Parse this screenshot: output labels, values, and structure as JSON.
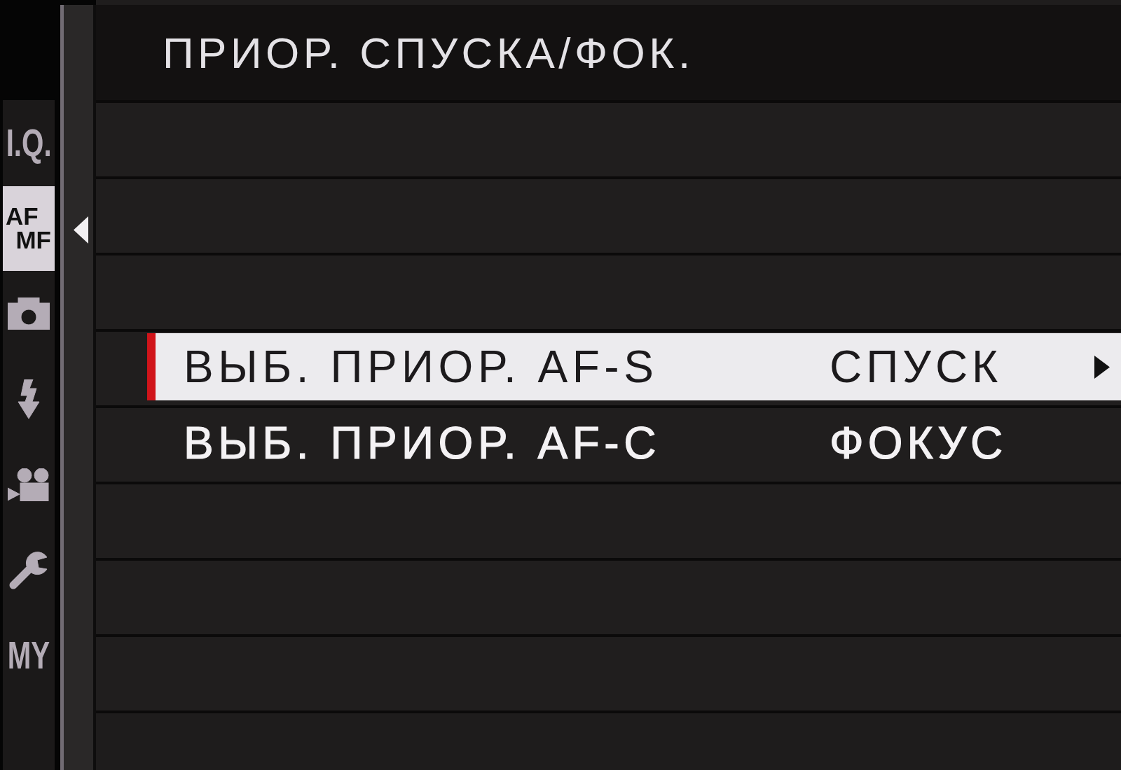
{
  "sidebar": {
    "tabs": [
      {
        "kind": "text",
        "label": "I.Q.",
        "selected": false
      },
      {
        "kind": "stacked",
        "lines": [
          "AF",
          "MF"
        ],
        "selected": true
      },
      {
        "kind": "camera",
        "selected": false
      },
      {
        "kind": "flash",
        "selected": false
      },
      {
        "kind": "movie",
        "selected": false
      },
      {
        "kind": "wrench",
        "selected": false
      },
      {
        "kind": "text",
        "label": "MY",
        "selected": false
      }
    ]
  },
  "menu": {
    "title": "ПРИОР. СПУСКА/ФОК.",
    "rows": [
      {
        "kind": "blank"
      },
      {
        "kind": "blank"
      },
      {
        "kind": "blank"
      },
      {
        "kind": "setting",
        "label": "ВЫБ. ПРИОР. AF-S",
        "value": "СПУСК",
        "selected": true
      },
      {
        "kind": "setting",
        "label": "ВЫБ. ПРИОР. AF-C",
        "value": "ФОКУС",
        "selected": false
      },
      {
        "kind": "blank"
      },
      {
        "kind": "blank"
      },
      {
        "kind": "blank"
      }
    ]
  }
}
